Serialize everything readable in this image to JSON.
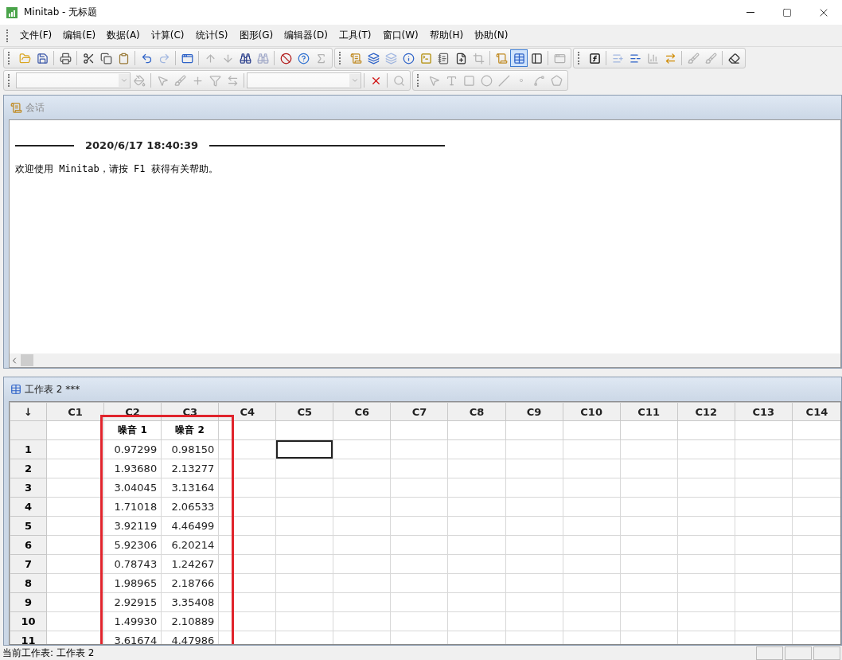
{
  "window": {
    "title": "Minitab - 无标题"
  },
  "menu": [
    {
      "label": "文件(F)"
    },
    {
      "label": "编辑(E)"
    },
    {
      "label": "数据(A)"
    },
    {
      "label": "计算(C)"
    },
    {
      "label": "统计(S)"
    },
    {
      "label": "图形(G)"
    },
    {
      "label": "编辑器(D)"
    },
    {
      "label": "工具(T)"
    },
    {
      "label": "窗口(W)"
    },
    {
      "label": "帮助(H)"
    },
    {
      "label": "协助(N)"
    }
  ],
  "toolbars": [
    [
      {
        "kind": "button",
        "disabled": false,
        "pressed": false
      },
      {
        "kind": "button",
        "disabled": false,
        "pressed": false
      },
      {
        "kind": "separator"
      },
      {
        "kind": "button",
        "disabled": false,
        "pressed": false
      },
      {
        "kind": "separator"
      },
      {
        "kind": "button",
        "disabled": false,
        "pressed": false
      },
      {
        "kind": "button",
        "disabled": false,
        "pressed": false
      },
      {
        "kind": "button",
        "disabled": false,
        "pressed": false
      },
      {
        "kind": "separator"
      },
      {
        "kind": "button",
        "disabled": false,
        "pressed": false
      },
      {
        "kind": "button",
        "disabled": true,
        "pressed": false
      },
      {
        "kind": "separator"
      },
      {
        "kind": "button",
        "disabled": false,
        "pressed": false
      },
      {
        "kind": "separator"
      },
      {
        "kind": "button",
        "disabled": true,
        "pressed": false
      },
      {
        "kind": "button",
        "disabled": true,
        "pressed": false
      },
      {
        "kind": "button",
        "disabled": false,
        "pressed": false
      },
      {
        "kind": "button",
        "disabled": true,
        "pressed": false
      },
      {
        "kind": "separator"
      },
      {
        "kind": "button",
        "disabled": false,
        "pressed": false
      },
      {
        "kind": "button",
        "disabled": false,
        "pressed": false
      },
      {
        "kind": "button",
        "disabled": true,
        "pressed": false
      },
      {
        "kind": "group"
      },
      {
        "kind": "button",
        "disabled": false,
        "pressed": false
      },
      {
        "kind": "button",
        "disabled": false,
        "pressed": false
      },
      {
        "kind": "button",
        "disabled": true,
        "pressed": false
      },
      {
        "kind": "button",
        "disabled": false,
        "pressed": false
      },
      {
        "kind": "button",
        "disabled": false,
        "pressed": false
      },
      {
        "kind": "button",
        "disabled": false,
        "pressed": false
      },
      {
        "kind": "button",
        "disabled": false,
        "pressed": false
      },
      {
        "kind": "button",
        "disabled": true,
        "pressed": false
      },
      {
        "kind": "separator"
      },
      {
        "kind": "button",
        "disabled": false,
        "pressed": false
      },
      {
        "kind": "button",
        "disabled": false,
        "pressed": true
      },
      {
        "kind": "button",
        "disabled": false,
        "pressed": false
      },
      {
        "kind": "separator"
      },
      {
        "kind": "button",
        "disabled": true,
        "pressed": false
      },
      {
        "kind": "group"
      },
      {
        "kind": "button",
        "disabled": false,
        "pressed": false
      },
      {
        "kind": "separator"
      },
      {
        "kind": "button",
        "disabled": true,
        "pressed": false
      },
      {
        "kind": "button",
        "disabled": false,
        "pressed": false
      },
      {
        "kind": "button",
        "disabled": true,
        "pressed": false
      },
      {
        "kind": "button",
        "disabled": false,
        "pressed": false
      },
      {
        "kind": "separator"
      },
      {
        "kind": "button",
        "disabled": true,
        "pressed": false
      },
      {
        "kind": "button",
        "disabled": true,
        "pressed": false
      },
      {
        "kind": "separator"
      },
      {
        "kind": "button",
        "disabled": false,
        "pressed": false
      }
    ],
    [
      {
        "kind": "combo",
        "disabled": true
      },
      {
        "kind": "button",
        "disabled": true,
        "pressed": false
      },
      {
        "kind": "separator"
      },
      {
        "kind": "button",
        "disabled": true,
        "pressed": false
      },
      {
        "kind": "button",
        "disabled": true,
        "pressed": false
      },
      {
        "kind": "button",
        "disabled": true,
        "pressed": false
      },
      {
        "kind": "button",
        "disabled": true,
        "pressed": false
      },
      {
        "kind": "button",
        "disabled": true,
        "pressed": false
      },
      {
        "kind": "separator"
      },
      {
        "kind": "combo",
        "disabled": true
      },
      {
        "kind": "separator"
      },
      {
        "kind": "button",
        "disabled": false,
        "pressed": false
      },
      {
        "kind": "separator"
      },
      {
        "kind": "button",
        "disabled": true,
        "pressed": false
      },
      {
        "kind": "group"
      },
      {
        "kind": "button",
        "disabled": true,
        "pressed": false
      },
      {
        "kind": "button",
        "disabled": true,
        "pressed": false
      },
      {
        "kind": "button",
        "disabled": true,
        "pressed": false
      },
      {
        "kind": "button",
        "disabled": true,
        "pressed": false
      },
      {
        "kind": "button",
        "disabled": true,
        "pressed": false
      },
      {
        "kind": "button",
        "disabled": true,
        "pressed": false
      },
      {
        "kind": "button",
        "disabled": true,
        "pressed": false
      },
      {
        "kind": "button",
        "disabled": true,
        "pressed": false
      }
    ]
  ],
  "session": {
    "title": "会话",
    "timestamp": "2020/6/17 18:40:39",
    "message": "欢迎使用 Minitab，请按 F1 获得有关帮助。"
  },
  "worksheet": {
    "title": "工作表 2 ***",
    "corner": "↓",
    "columns": [
      {
        "label": "C1"
      },
      {
        "label": "C2",
        "name": "噪音 1"
      },
      {
        "label": "C3",
        "name": "噪音 2"
      },
      {
        "label": "C4"
      },
      {
        "label": "C5"
      },
      {
        "label": "C6"
      },
      {
        "label": "C7"
      },
      {
        "label": "C8"
      },
      {
        "label": "C9"
      },
      {
        "label": "C10"
      },
      {
        "label": "C11"
      },
      {
        "label": "C12"
      },
      {
        "label": "C13"
      },
      {
        "label": "C14"
      }
    ],
    "rows": [
      {
        "label": "1",
        "cells": [
          {
            "selected": false
          },
          {
            "value": "0.97299",
            "selected": false
          },
          {
            "value": "0.98150",
            "selected": false
          },
          {
            "selected": false
          },
          {
            "selected": true
          }
        ]
      },
      {
        "label": "2",
        "cells": [
          {
            "selected": false
          },
          {
            "value": "1.93680",
            "selected": false
          },
          {
            "value": "2.13277",
            "selected": false
          },
          {
            "selected": false
          },
          {
            "selected": false
          }
        ]
      },
      {
        "label": "3",
        "cells": [
          {
            "selected": false
          },
          {
            "value": "3.04045",
            "selected": false
          },
          {
            "value": "3.13164",
            "selected": false
          },
          {
            "selected": false
          },
          {
            "selected": false
          }
        ]
      },
      {
        "label": "4",
        "cells": [
          {
            "selected": false
          },
          {
            "value": "1.71018",
            "selected": false
          },
          {
            "value": "2.06533",
            "selected": false
          },
          {
            "selected": false
          },
          {
            "selected": false
          }
        ]
      },
      {
        "label": "5",
        "cells": [
          {
            "selected": false
          },
          {
            "value": "3.92119",
            "selected": false
          },
          {
            "value": "4.46499",
            "selected": false
          },
          {
            "selected": false
          },
          {
            "selected": false
          }
        ]
      },
      {
        "label": "6",
        "cells": [
          {
            "selected": false
          },
          {
            "value": "5.92306",
            "selected": false
          },
          {
            "value": "6.20214",
            "selected": false
          },
          {
            "selected": false
          },
          {
            "selected": false
          }
        ]
      },
      {
        "label": "7",
        "cells": [
          {
            "selected": false
          },
          {
            "value": "0.78743",
            "selected": false
          },
          {
            "value": "1.24267",
            "selected": false
          },
          {
            "selected": false
          },
          {
            "selected": false
          }
        ]
      },
      {
        "label": "8",
        "cells": [
          {
            "selected": false
          },
          {
            "value": "1.98965",
            "selected": false
          },
          {
            "value": "2.18766",
            "selected": false
          },
          {
            "selected": false
          },
          {
            "selected": false
          }
        ]
      },
      {
        "label": "9",
        "cells": [
          {
            "selected": false
          },
          {
            "value": "2.92915",
            "selected": false
          },
          {
            "value": "3.35408",
            "selected": false
          },
          {
            "selected": false
          },
          {
            "selected": false
          }
        ]
      },
      {
        "label": "10",
        "cells": [
          {
            "selected": false
          },
          {
            "value": "1.49930",
            "selected": false
          },
          {
            "value": "2.10889",
            "selected": false
          },
          {
            "selected": false
          },
          {
            "selected": false
          }
        ]
      },
      {
        "label": "11",
        "cells": [
          {
            "selected": false
          },
          {
            "value": "3.61674",
            "selected": false
          },
          {
            "value": "4.47986",
            "selected": false
          },
          {
            "selected": false
          },
          {
            "selected": false
          }
        ]
      }
    ]
  },
  "status_bar": {
    "text": "当前工作表: 工作表 2"
  }
}
